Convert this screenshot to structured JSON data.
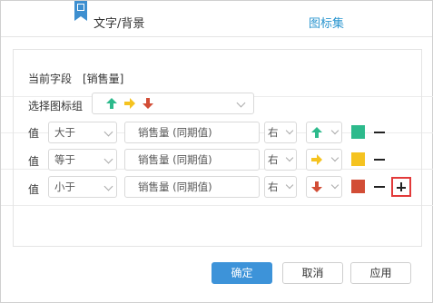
{
  "tabs": {
    "text_bg": "文字/背景",
    "icon_set": "图标集"
  },
  "current_field": {
    "label": "当前字段",
    "value": "[销售量]"
  },
  "icon_group": {
    "label": "选择图标组",
    "icons": [
      "arrow-up-green-icon",
      "arrow-right-yellow-icon",
      "arrow-down-red-icon"
    ]
  },
  "rules": [
    {
      "label": "值",
      "operator": "大于",
      "value_field": "销售量 (同期值)",
      "side": "右",
      "icon": "arrow-up-green-icon",
      "color": "#2dba8c"
    },
    {
      "label": "值",
      "operator": "等于",
      "value_field": "销售量 (同期值)",
      "side": "右",
      "icon": "arrow-right-yellow-icon",
      "color": "#f5c320"
    },
    {
      "label": "值",
      "operator": "小于",
      "value_field": "销售量 (同期值)",
      "side": "右",
      "icon": "arrow-down-red-icon",
      "color": "#d24d36"
    }
  ],
  "colors": {
    "green": "#2dba8c",
    "yellow": "#f5c320",
    "red": "#d24d36",
    "accent": "#2a95cf",
    "primary_button": "#3d93d9"
  },
  "buttons": {
    "ok": "确定",
    "cancel": "取消",
    "apply": "应用"
  }
}
